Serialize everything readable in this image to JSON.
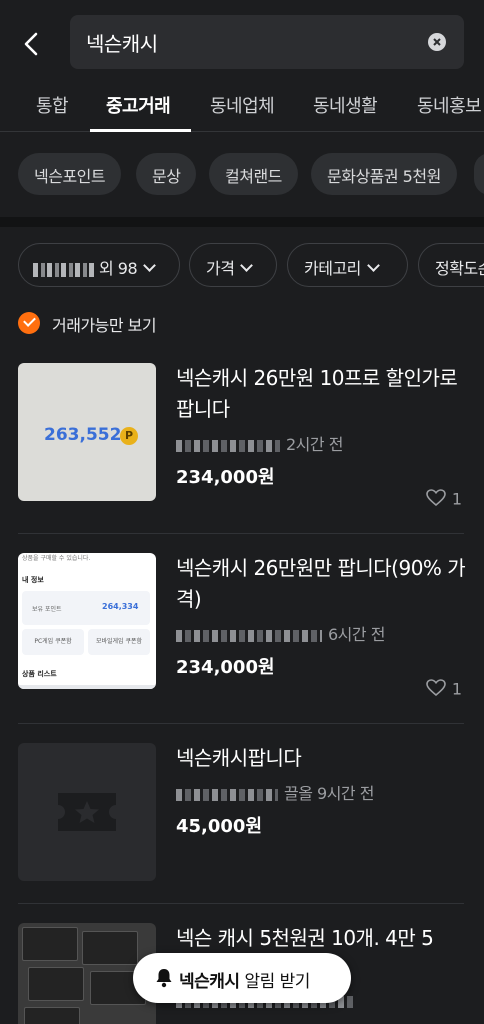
{
  "search": {
    "query": "넥슨캐시"
  },
  "tabs": [
    "통합",
    "중고거래",
    "동네업체",
    "동네생활",
    "동네홍보"
  ],
  "active_tab": "중고거래",
  "related_keywords": [
    "넥슨포인트",
    "문상",
    "컬쳐랜드",
    "문화상품권 5천원"
  ],
  "filters": {
    "location_suffix": "외 98",
    "price": "가격",
    "category": "카테고리",
    "sort": "정확도순"
  },
  "available_only_label": "거래가능만 보기",
  "listings": [
    {
      "title": "넥슨캐시 26만원 10프로 할인가로 팝니다",
      "time": "2시간 전",
      "price": "234,000원",
      "likes": "1",
      "thumb_amount": "263,552",
      "thumb_coin": "P"
    },
    {
      "title": "넥슨캐시 26만원만 팝니다(90% 가격)",
      "time": "6시간 전",
      "price": "234,000원",
      "likes": "1",
      "thumb_top": "상품을 구매할 수 있습니다.",
      "thumb_heading": "내 정보",
      "thumb_point_label": "보유 포인트",
      "thumb_point_value": "264,334",
      "thumb_btn1": "PC게임 쿠폰함",
      "thumb_btn2": "모바일게임 쿠폰함",
      "thumb_list": "상품 리스트"
    },
    {
      "title": "넥슨캐시팝니다",
      "time": "끌올 9시간 전",
      "price": "45,000원",
      "likes": ""
    },
    {
      "title": "넥슨 캐시 5천원권 10개. 4만 5",
      "time": "",
      "price": "",
      "likes": ""
    }
  ],
  "alert": {
    "keyword": "넥슨캐시",
    "suffix": " 알림 받기"
  },
  "colors": {
    "accent": "#ff6f0f",
    "background": "#1c1d1f"
  }
}
